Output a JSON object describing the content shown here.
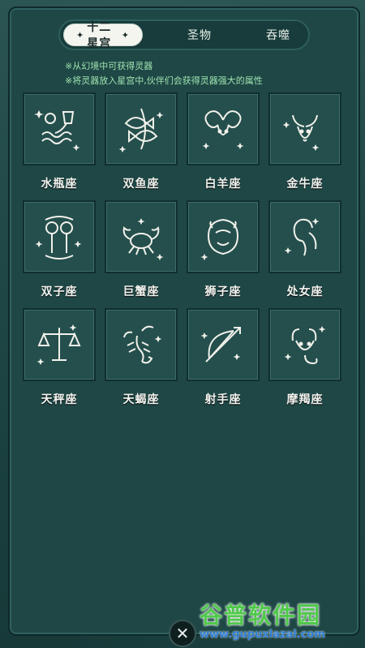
{
  "tabs": [
    {
      "label": "十二星宫",
      "active": true
    },
    {
      "label": "圣物",
      "active": false
    },
    {
      "label": "吞噬",
      "active": false
    }
  ],
  "hints": [
    "※从幻境中可获得灵器",
    "※将灵器放入星宫中,伙伴们会获得灵器强大的属性"
  ],
  "signs": [
    {
      "label": "水瓶座",
      "icon": "aquarius-icon"
    },
    {
      "label": "双鱼座",
      "icon": "pisces-icon"
    },
    {
      "label": "白羊座",
      "icon": "aries-icon"
    },
    {
      "label": "金牛座",
      "icon": "taurus-icon"
    },
    {
      "label": "双子座",
      "icon": "gemini-icon"
    },
    {
      "label": "巨蟹座",
      "icon": "cancer-icon"
    },
    {
      "label": "狮子座",
      "icon": "leo-icon"
    },
    {
      "label": "处女座",
      "icon": "virgo-icon"
    },
    {
      "label": "天秤座",
      "icon": "libra-icon"
    },
    {
      "label": "天蝎座",
      "icon": "scorpio-icon"
    },
    {
      "label": "射手座",
      "icon": "sagittarius-icon"
    },
    {
      "label": "摩羯座",
      "icon": "capricorn-icon"
    }
  ],
  "close_icon": "close-icon",
  "watermark": {
    "title": "谷普软件园",
    "url": "www.gupuxlazal.com"
  },
  "colors": {
    "hint": "#9fe3b0",
    "panel": "#1e4745",
    "accent": "#f3f5ee"
  }
}
